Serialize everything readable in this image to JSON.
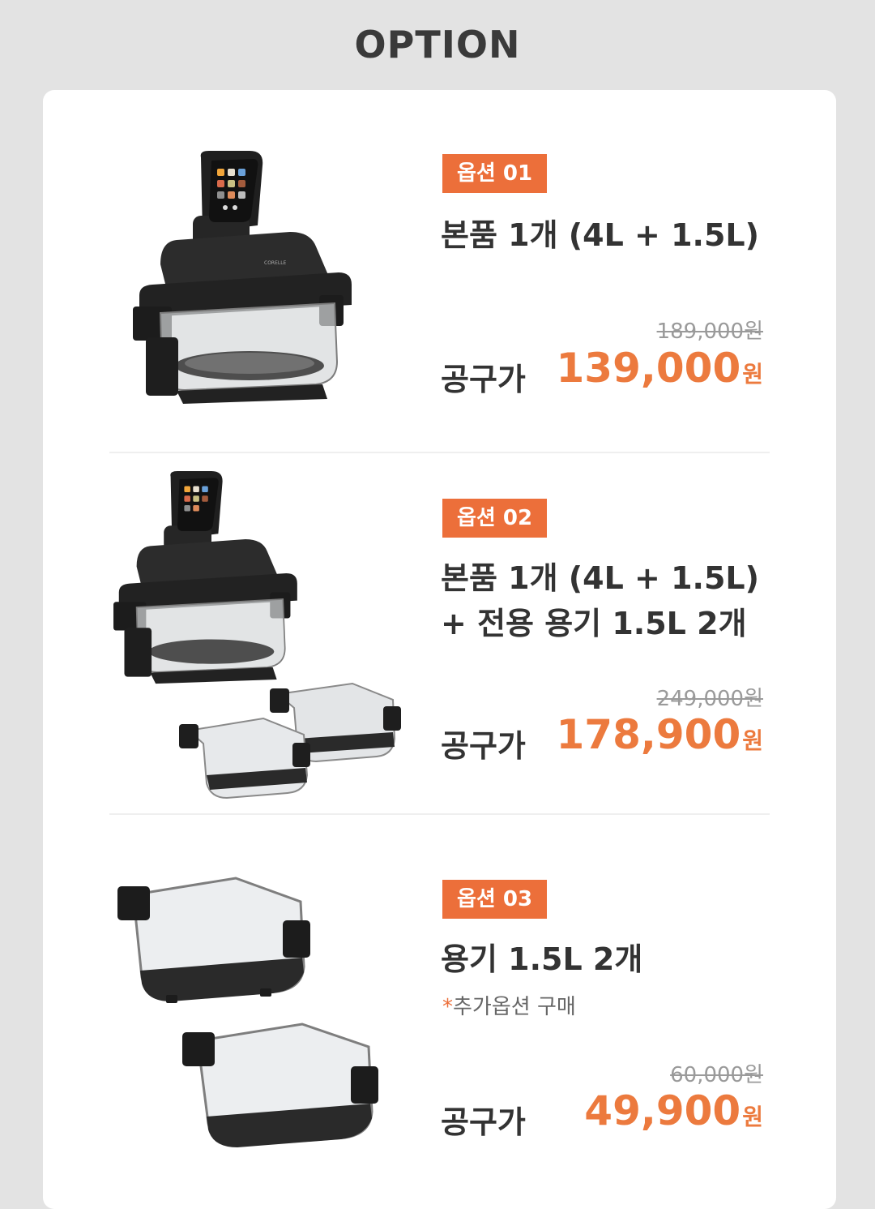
{
  "header": {
    "title": "OPTION"
  },
  "options": [
    {
      "badge": "옵션 01",
      "name_line1": "본품 1개 (4L + 1.5L)",
      "original_price": "189,000원",
      "price_label": "공구가",
      "price": "139,000",
      "currency": "원"
    },
    {
      "badge": "옵션 02",
      "name_line1": "본품 1개 (4L + 1.5L)",
      "name_line2": "+ 전용 용기 1.5L 2개",
      "original_price": "249,000원",
      "price_label": "공구가",
      "price": "178,900",
      "currency": "원"
    },
    {
      "badge": "옵션 03",
      "name_line1": "용기 1.5L 2개",
      "note_star": "*",
      "note": "추가옵션 구매",
      "original_price": "60,000원",
      "price_label": "공구가",
      "price": "49,900",
      "currency": "원"
    }
  ],
  "product": {
    "brand": "CORELLE"
  },
  "colors": {
    "accent": "#ec6f3a",
    "background": "#e3e3e3",
    "card": "#ffffff"
  }
}
